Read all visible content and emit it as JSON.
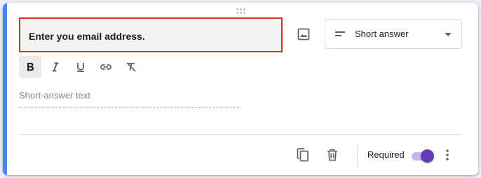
{
  "question": {
    "title": "Enter you email address."
  },
  "type_select": {
    "label": "Short answer"
  },
  "answer": {
    "placeholder": "Short-answer text"
  },
  "footer": {
    "required_label": "Required",
    "required_on": true
  },
  "colors": {
    "accent": "#4285f4",
    "highlight_border": "#d93025",
    "toggle": "#673ab7"
  },
  "icons": [
    "drag-handle-icon",
    "image-icon",
    "short-answer-icon",
    "dropdown-caret-icon",
    "bold-icon",
    "italic-icon",
    "underline-icon",
    "link-icon",
    "clear-formatting-icon",
    "duplicate-icon",
    "delete-icon",
    "more-vert-icon"
  ]
}
